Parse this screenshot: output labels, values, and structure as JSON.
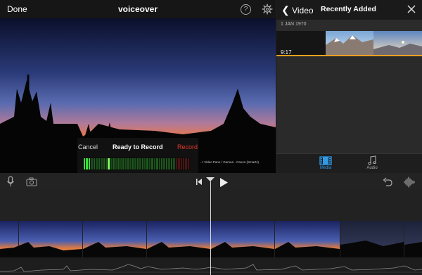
{
  "topbar": {
    "done_label": "Done",
    "project_title": "voiceover",
    "help_label": "?"
  },
  "record_panel": {
    "cancel_label": "Cancel",
    "status_label": "Ready to Record",
    "record_label": "Record"
  },
  "overlay_caption": "...t Video Pane / Gamea · Canon (Smart4)",
  "media_browser": {
    "back_label": "Video",
    "title": "Recently Added",
    "date_label": "1 JAN 1970",
    "clip_duration": "9:17",
    "tabs": [
      {
        "label": "Media",
        "active": true
      },
      {
        "label": "Audio",
        "active": false
      }
    ]
  },
  "colors": {
    "accent": "#2f9be8",
    "record_red": "#e5392b",
    "clip_progress": "#f0a020"
  }
}
